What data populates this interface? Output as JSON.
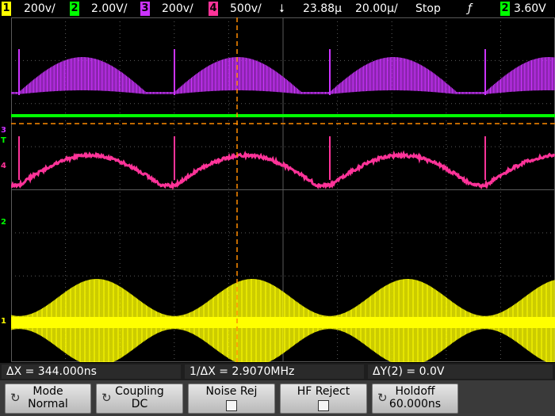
{
  "topbar": {
    "ch1_num": "1",
    "ch1_scale": "200v/",
    "ch2_num": "2",
    "ch2_scale": "2.00V/",
    "ch3_num": "3",
    "ch3_scale": "200v/",
    "ch4_num": "4",
    "ch4_scale": "500v/",
    "time_offset": "23.88µ",
    "timebase": "20.00µ/",
    "run_state": "Stop",
    "trigger_icon": "trigger-edge-icon",
    "trigger_source": "2",
    "trigger_level": "3.60V"
  },
  "colors": {
    "ch1": "#ffff00",
    "ch2": "#00ff00",
    "ch3": "#cc33ff",
    "ch4": "#ff3399",
    "cursor": "#ff8c00",
    "grid": "#5a5a5a"
  },
  "markers": {
    "ch3": "3",
    "trig": "T",
    "ch4": "4",
    "ch2": "2",
    "ch1": "1"
  },
  "info": {
    "delta_x": "ΔX = 344.000ns",
    "inv_delta_x": "1/ΔX = 2.9070MHz",
    "delta_y": "ΔY(2) = 0.0V"
  },
  "softkeys": [
    {
      "label": "Mode",
      "value": "Normal",
      "icon": "knob-icon"
    },
    {
      "label": "Coupling",
      "value": "DC",
      "icon": "knob-icon"
    },
    {
      "label": "Noise Rej",
      "value": "",
      "icon": "checkbox-icon"
    },
    {
      "label": "HF Reject",
      "value": "",
      "icon": "checkbox-icon"
    },
    {
      "label": "Holdoff",
      "value": "60.000ns",
      "icon": "knob-icon"
    }
  ]
}
